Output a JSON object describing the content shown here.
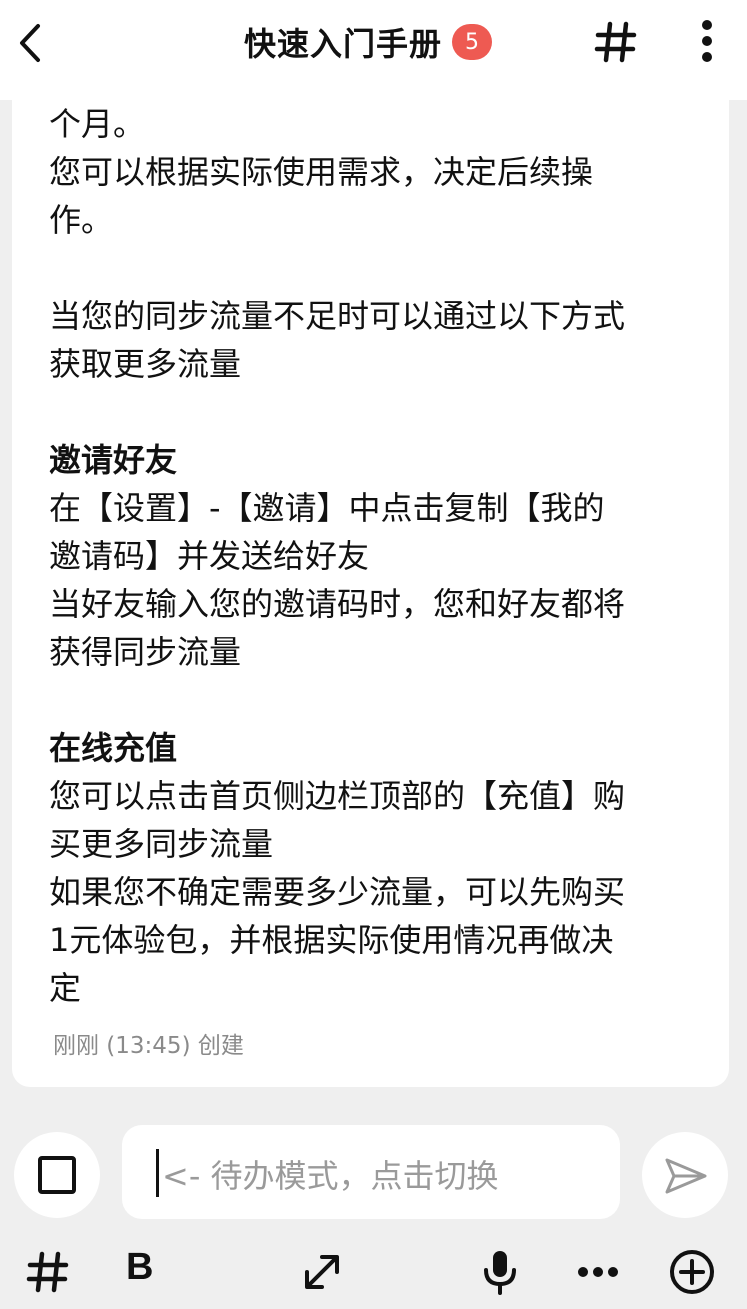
{
  "header": {
    "title": "快速入门手册",
    "badge_count": "5",
    "accent_color": "#ee5a52"
  },
  "note": {
    "lines": [
      {
        "text": "个月。",
        "bold": false
      },
      {
        "text": "您可以根据实际使用需求，决定后续操",
        "bold": false
      },
      {
        "text": "作。",
        "bold": false
      },
      {
        "text": "",
        "bold": false
      },
      {
        "text": "当您的同步流量不足时可以通过以下方式",
        "bold": false
      },
      {
        "text": "获取更多流量",
        "bold": false
      },
      {
        "text": "",
        "bold": false
      },
      {
        "text": "邀请好友",
        "bold": true
      },
      {
        "text": "在【设置】-【邀请】中点击复制【我的",
        "bold": false
      },
      {
        "text": "邀请码】并发送给好友",
        "bold": false
      },
      {
        "text": "当好友输入您的邀请码时，您和好友都将",
        "bold": false
      },
      {
        "text": "获得同步流量",
        "bold": false
      },
      {
        "text": "",
        "bold": false
      },
      {
        "text": "在线充值",
        "bold": true
      },
      {
        "text": "您可以点击首页侧边栏顶部的【充值】购",
        "bold": false
      },
      {
        "text": "买更多同步流量",
        "bold": false
      },
      {
        "text": "如果您不确定需要多少流量，可以先购买",
        "bold": false
      },
      {
        "text": "1元体验包，并根据实际使用情况再做决",
        "bold": false
      },
      {
        "text": "定",
        "bold": false
      }
    ],
    "meta": "刚刚 (13:45) 创建"
  },
  "composer": {
    "placeholder": "<- 待办模式，点击切换"
  },
  "toolbar": {
    "bold_label": "B",
    "icons": [
      "hashtag-icon",
      "bold-icon",
      "expand-icon",
      "microphone-icon",
      "more-horizontal-icon",
      "add-circle-icon"
    ]
  }
}
